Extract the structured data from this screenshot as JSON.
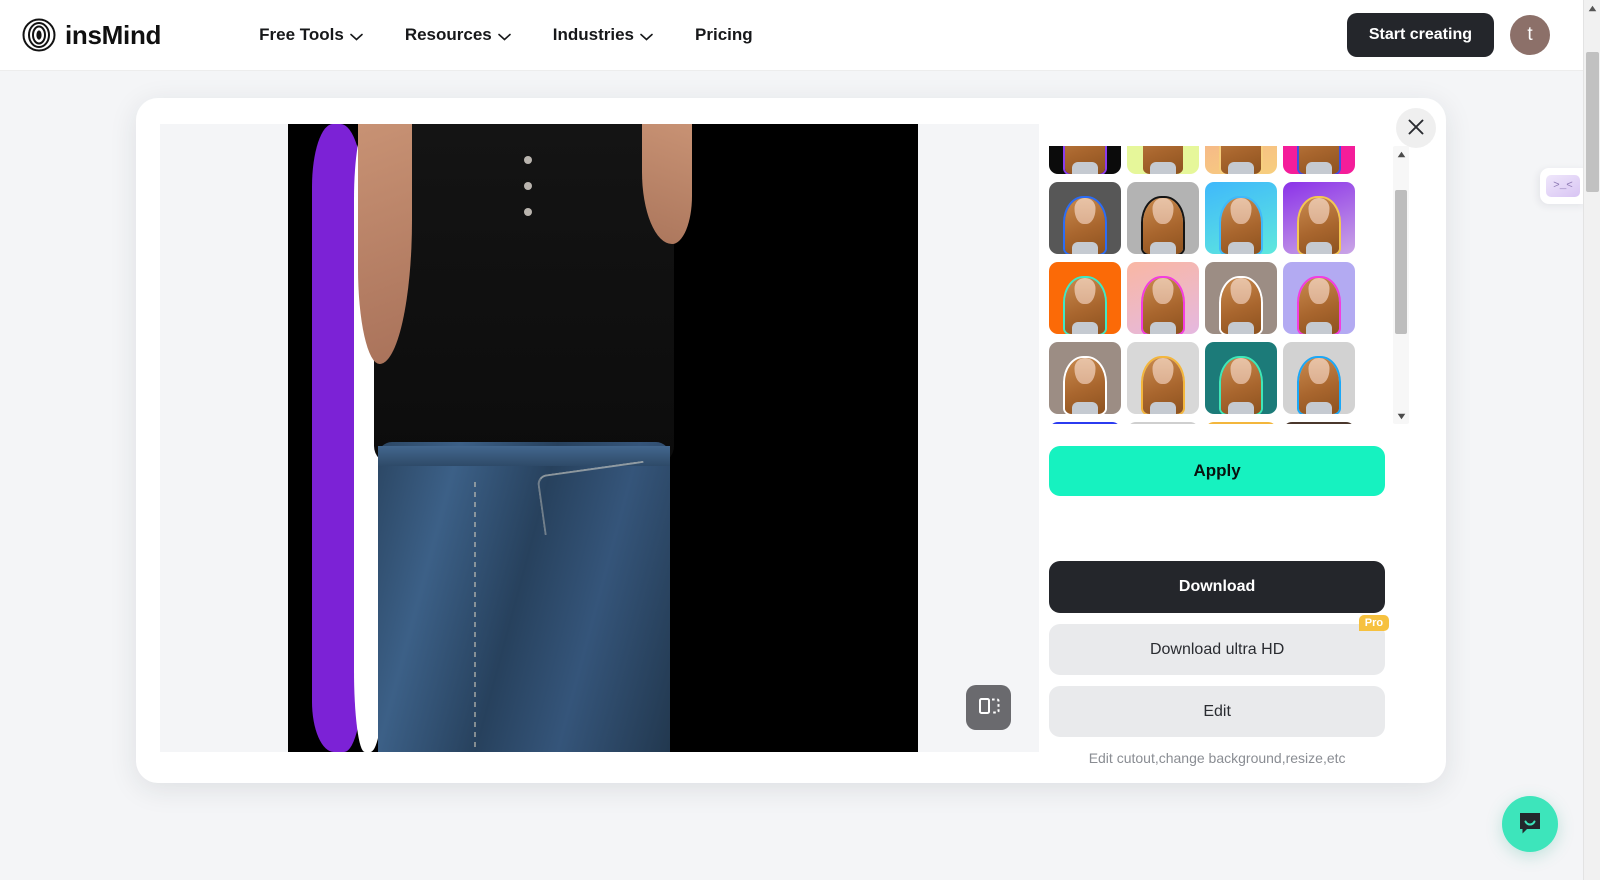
{
  "header": {
    "brand": "insMind",
    "brand_logo_icon": "concentric-circles-logo",
    "nav": [
      {
        "label": "Free Tools",
        "has_caret": true,
        "icon": "chevron-down-icon"
      },
      {
        "label": "Resources",
        "has_caret": true,
        "icon": "chevron-down-icon"
      },
      {
        "label": "Industries",
        "has_caret": true,
        "icon": "chevron-down-icon"
      },
      {
        "label": "Pricing",
        "has_caret": false,
        "icon": ""
      }
    ],
    "start_creating_label": "Start creating",
    "avatar_initial": "t"
  },
  "modal": {
    "close_icon": "close-icon",
    "compare_icon": "compare-split-view-icon",
    "scroll_up_icon": "triangle-up-icon",
    "scroll_down_icon": "triangle-down-icon"
  },
  "preview": {
    "background_color": "#000000",
    "outline_colors": [
      "#ffffff",
      "#7c22d6"
    ],
    "subject_description": "person in black sleeveless top and blue jeans"
  },
  "thumbnails": {
    "selected_index": 0,
    "items": [
      {
        "name": "preset-black-purple",
        "bg": "#0b0b0b",
        "bg2": "#0b0b0b",
        "stroke": "#8b3bf0",
        "selected": true,
        "partial": "top"
      },
      {
        "name": "preset-lime",
        "bg": "#e6f79a",
        "bg2": "#e6f79a",
        "stroke": "#e6f79a",
        "selected": false,
        "partial": "top"
      },
      {
        "name": "preset-peach-amber",
        "bg": "#f6a98e",
        "bg2": "#f7cf7e",
        "stroke": "#f7cf7e",
        "selected": false,
        "partial": "top"
      },
      {
        "name": "preset-magenta",
        "bg": "#f41d9a",
        "bg2": "#f41d9a",
        "stroke": "#3f4fe0",
        "selected": false,
        "partial": "top"
      },
      {
        "name": "preset-darkgrey-blue",
        "bg": "#575757",
        "bg2": "#575757",
        "stroke": "#2b6cf6",
        "selected": false,
        "partial": ""
      },
      {
        "name": "preset-grey-black",
        "bg": "#b3b3b3",
        "bg2": "#b3b3b3",
        "stroke": "#141414",
        "selected": false,
        "partial": ""
      },
      {
        "name": "preset-skyblue-cyan",
        "bg": "#3fb8fb",
        "bg2": "#5fe8dd",
        "stroke": "#3fb8fb",
        "selected": false,
        "partial": ""
      },
      {
        "name": "preset-violet-gold",
        "bg": "#8b32e8",
        "bg2": "#caa6e6",
        "stroke": "#f5c84f",
        "selected": false,
        "partial": ""
      },
      {
        "name": "preset-orange-mint",
        "bg": "#fb6a07",
        "bg2": "#fb6a07",
        "stroke": "#3fe8c5",
        "selected": false,
        "partial": ""
      },
      {
        "name": "preset-pink-magenta",
        "bg": "#f9b7a3",
        "bg2": "#e5b8e0",
        "stroke": "#f33ce0",
        "selected": false,
        "partial": ""
      },
      {
        "name": "preset-taupe-white",
        "bg": "#9c8d84",
        "bg2": "#9c8d84",
        "stroke": "#ffffff",
        "selected": false,
        "partial": ""
      },
      {
        "name": "preset-periwinkle-pink",
        "bg": "#b3aaf2",
        "bg2": "#b3aaf2",
        "stroke": "#f33ce0",
        "selected": false,
        "partial": ""
      },
      {
        "name": "preset-mocha-white",
        "bg": "#9c8d84",
        "bg2": "#9c8d84",
        "stroke": "#ffffff",
        "selected": false,
        "partial": ""
      },
      {
        "name": "preset-lightgrey-gold",
        "bg": "#d8d8d8",
        "bg2": "#d8d8d8",
        "stroke": "#f3b63c",
        "selected": false,
        "partial": ""
      },
      {
        "name": "preset-teal-mint",
        "bg": "#1c7b79",
        "bg2": "#1c7b79",
        "stroke": "#3fe8b8",
        "selected": false,
        "partial": ""
      },
      {
        "name": "preset-grey-cyan",
        "bg": "#d2d2d2",
        "bg2": "#d2d2d2",
        "stroke": "#1aa7f7",
        "selected": false,
        "partial": ""
      },
      {
        "name": "preset-blue",
        "bg": "#2b3bf0",
        "bg2": "#2b3bf0",
        "stroke": "#2b3bf0",
        "selected": false,
        "partial": "bottom"
      },
      {
        "name": "preset-silver",
        "bg": "#cfcfcf",
        "bg2": "#cfcfcf",
        "stroke": "#cfcfcf",
        "selected": false,
        "partial": "bottom"
      },
      {
        "name": "preset-amber",
        "bg": "#f3b63c",
        "bg2": "#f3b63c",
        "stroke": "#f3b63c",
        "selected": false,
        "partial": "bottom"
      },
      {
        "name": "preset-brown",
        "bg": "#4a372c",
        "bg2": "#4a372c",
        "stroke": "#4a372c",
        "selected": false,
        "partial": "bottom"
      }
    ]
  },
  "actions": {
    "apply_label": "Apply",
    "download_label": "Download",
    "download_ultra_hd_label": "Download ultra HD",
    "pro_badge": "Pro",
    "edit_label": "Edit",
    "hint": "Edit cutout,change background,resize,etc"
  },
  "widgets": {
    "side_widget_face": ">_<",
    "side_widget_icon": "emoticon-face-icon",
    "chat_icon": "chat-bubble-icon"
  },
  "colors": {
    "accent_teal": "#16f2c0",
    "dark": "#24262b",
    "pro_yellow": "#f6c13f",
    "outline_purple": "#7c22d6"
  }
}
